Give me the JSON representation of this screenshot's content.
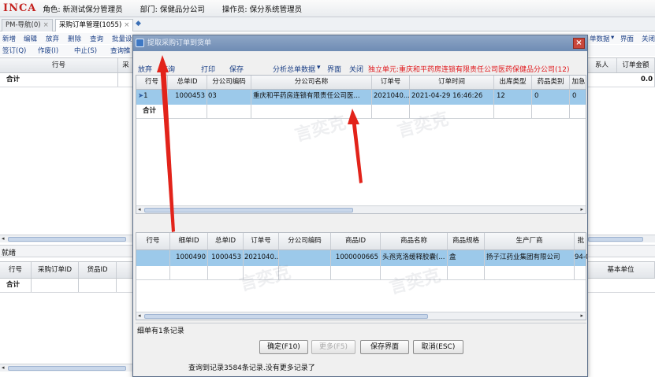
{
  "topbar": {
    "logo": "INCA",
    "role": "角色: 新测试保分管理员",
    "dept": "部门: 保健品分公司",
    "operator": "操作员: 保分系统管理员"
  },
  "tabs": [
    {
      "label": "PM-导航(0)",
      "close": "×"
    },
    {
      "label": "采购订单管理(1055)",
      "close": "×"
    }
  ],
  "main": {
    "toolbar1": [
      "新增",
      "编辑",
      "放弃",
      "删除",
      "查询",
      "批量设"
    ],
    "toolbar2": [
      "签订(Q)",
      "作废(I)",
      "中止(S)",
      "查询推"
    ],
    "toolbar1_right": [
      "单数据",
      "▾",
      "界面",
      "关闭"
    ],
    "grid1_headers": {
      "row_no": "行号",
      "col2": "采",
      "contact": "系人",
      "amount": "订单金额"
    },
    "grid1_sum": "合计",
    "grid1_sum_value": "0.0",
    "status": "就绪",
    "grid2_headers": {
      "row_no": "行号",
      "po_id": "采购订单ID",
      "item_id": "货品ID",
      "unit": "基本单位"
    },
    "grid2_sum": "合计"
  },
  "dialog": {
    "title": "提取采购订单到货单",
    "close": "×",
    "toolbar": {
      "abandon": "放弃",
      "query": "查询",
      "print": "打印",
      "save": "保存",
      "analyze": "分析总单数据",
      "analyze_caret": "▾",
      "ui": "界面",
      "close": "关闭",
      "unit_info": "独立单元:重庆和平药房连锁有限责任公司医药保健品分公司(12)"
    },
    "master_headers": [
      "行号",
      "总单ID",
      "分公司编码",
      "分公司名称",
      "订单号",
      "订单时间",
      "出库类型",
      "药品类别",
      "加急"
    ],
    "master_rows": [
      {
        "row": "1",
        "id": "1000453",
        "code": "03",
        "name": "重庆和平药房连锁有限责任公司医...",
        "order_no": "2021040...",
        "time": "2021-04-29 16:46:26",
        "out_type": "12",
        "category": "0",
        "urgent": "0"
      }
    ],
    "master_sum": "合计",
    "detail_headers": [
      "行号",
      "细单ID",
      "总单ID",
      "订单号",
      "分公司编码",
      "商品ID",
      "商品名称",
      "商品规格",
      "生产厂商",
      "批"
    ],
    "detail_rows": [
      {
        "row": "",
        "detail_id": "1000490",
        "master_id": "1000453",
        "order_no": "2021040...",
        "code": "",
        "goods_id": "1000000665",
        "goods_name": "头孢克洛缓释胶囊(...",
        "spec": "盒",
        "maker": "扬子江药业集团有限公司",
        "batch": "94-0"
      }
    ],
    "detail_count": "细单有1条记录",
    "buttons": {
      "ok": "确定(F10)",
      "more": "更多(F5)",
      "save_ui": "保存界面",
      "cancel": "取消(ESC)"
    },
    "status": "查询到记录3584条记录.没有更多记录了"
  },
  "watermark": "言奕克",
  "colors": {
    "accent": "#1b3f86",
    "selection": "#9cc9ea",
    "alert_red": "#e0171b",
    "logo_red": "#c4221f",
    "title_bar": "#7891b8"
  },
  "icons": [
    "app-logo",
    "dialog-app-icon",
    "close-icon",
    "row-pointer-icon",
    "scroll-left-icon",
    "scroll-right-icon",
    "red-arrow-annotation"
  ]
}
